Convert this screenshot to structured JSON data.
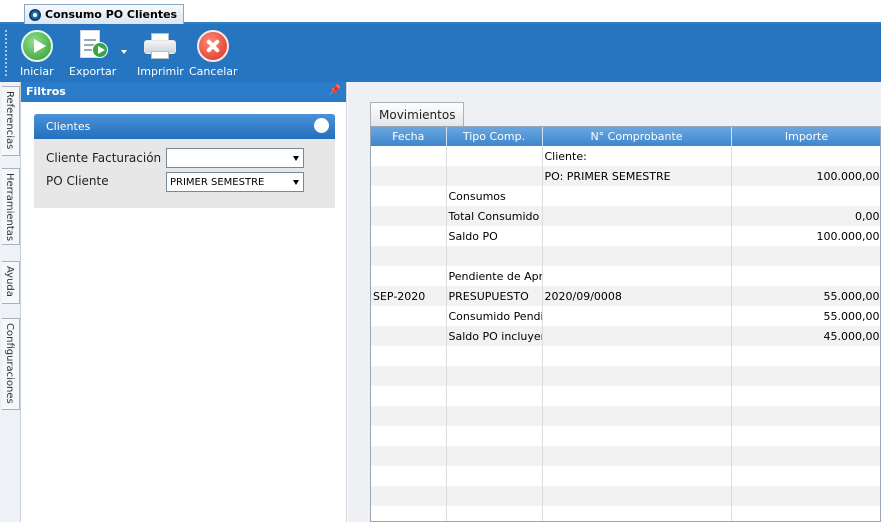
{
  "window": {
    "tab_title": "Consumo PO Clientes"
  },
  "toolbar": {
    "iniciar": "Iniciar",
    "exportar": "Exportar",
    "imprimir": "Imprimir",
    "cancelar": "Cancelar",
    "accent_color": "#2575c0"
  },
  "side_tabs": [
    "Referencias",
    "Herramientas",
    "Ayuda",
    "Configuraciones"
  ],
  "filters": {
    "title": "Filtros",
    "group_title": "Clientes",
    "cliente_facturacion_label": "Cliente Facturación",
    "cliente_facturacion_value": "",
    "po_cliente_label": "PO Cliente",
    "po_cliente_value": "PRIMER SEMESTRE"
  },
  "movimientos": {
    "tab_label": "Movimientos",
    "columns": [
      "Fecha",
      "Tipo Comp.",
      "N° Comprobante",
      "Importe"
    ],
    "rows": [
      [
        "",
        "",
        "Cliente:",
        ""
      ],
      [
        "",
        "",
        "PO: PRIMER SEMESTRE",
        "100.000,00"
      ],
      [
        "",
        "Consumos",
        "",
        ""
      ],
      [
        "",
        "Total Consumido",
        "",
        "0,00"
      ],
      [
        "",
        "Saldo PO",
        "",
        "100.000,00"
      ],
      [
        "",
        "",
        "",
        ""
      ],
      [
        "",
        "Pendiente de Aprobar",
        "",
        ""
      ],
      [
        "SEP-2020",
        "PRESUPUESTO",
        "2020/09/0008",
        "55.000,00"
      ],
      [
        "",
        "Consumido Pendiente Aprobar",
        "",
        "55.000,00"
      ],
      [
        "",
        "Saldo PO incluyendo pend aprobar",
        "",
        "45.000,00"
      ],
      [
        "",
        "",
        "",
        ""
      ],
      [
        "",
        "",
        "",
        ""
      ],
      [
        "",
        "",
        "",
        ""
      ],
      [
        "",
        "",
        "",
        ""
      ],
      [
        "",
        "",
        "",
        ""
      ],
      [
        "",
        "",
        "",
        ""
      ],
      [
        "",
        "",
        "",
        ""
      ],
      [
        "",
        "",
        "",
        ""
      ],
      [
        "",
        "",
        "",
        ""
      ]
    ]
  }
}
